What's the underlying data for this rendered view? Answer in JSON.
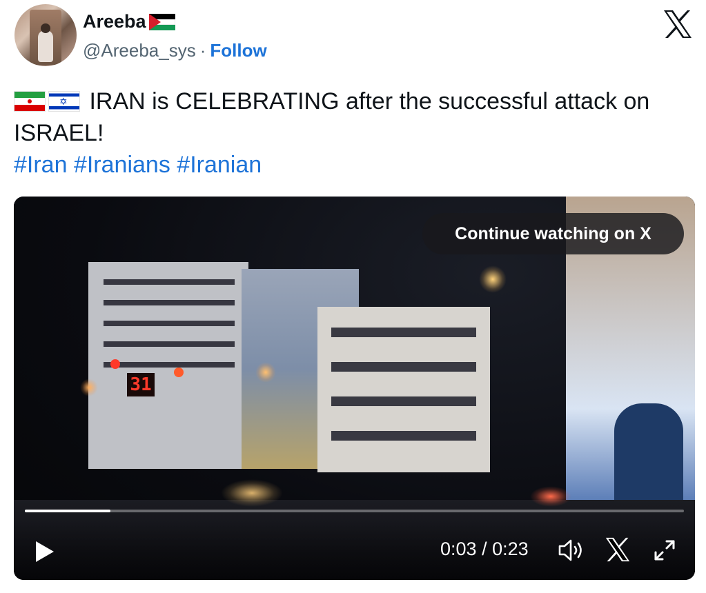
{
  "author": {
    "display_name": "Areeba",
    "flag_icon": "palestine-flag-icon",
    "handle": "@Areeba_sys",
    "separator": "·",
    "follow_label": "Follow"
  },
  "brand_icon": "x-logo-icon",
  "tweet": {
    "flags": [
      "iran-flag-icon",
      "israel-flag-icon"
    ],
    "text": "IRAN is CELEBRATING after the successful attack on ISRAEL!",
    "hashtags": [
      "#Iran",
      "#Iranians",
      "#Iranian"
    ]
  },
  "video": {
    "continue_label": "Continue watching on X",
    "current_time": "0:03",
    "time_separator": " / ",
    "duration": "0:23",
    "progress_fraction": 0.13,
    "sign_number": "31",
    "icons": [
      "play-icon",
      "volume-icon",
      "x-logo-icon",
      "fullscreen-icon"
    ]
  },
  "colors": {
    "link": "#1d73d8",
    "text": "#0f1419",
    "muted": "#536471"
  }
}
